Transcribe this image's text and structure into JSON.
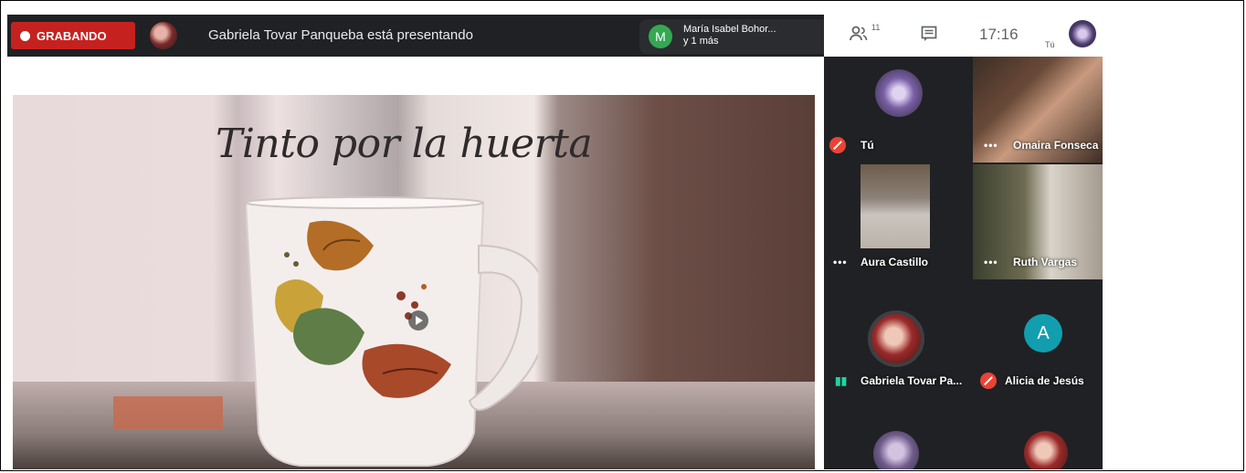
{
  "topbar": {
    "recording_label": "GRABANDO",
    "presenting_text": "Gabriela Tovar Panqueba está presentando",
    "host": {
      "initial": "M",
      "name_line1": "María Isabel Bohor...",
      "name_line2": "y 1 más"
    }
  },
  "side_controls": {
    "people_count": "11",
    "time": "17:16",
    "you_label": "Tú"
  },
  "slide": {
    "title": "Tinto por la huerta"
  },
  "participants": [
    {
      "name": "Tú",
      "muted": true
    },
    {
      "name": "Omaira Fonseca",
      "muted": false
    },
    {
      "name": "Aura Castillo",
      "muted": false
    },
    {
      "name": "Ruth Vargas",
      "muted": false
    },
    {
      "name": "Gabriela Tovar Pa...",
      "speaking": true
    },
    {
      "name": "Alicia de Jesús",
      "muted": true,
      "initial": "A"
    }
  ],
  "colors": {
    "meet_dark": "#202124",
    "record_red": "#c5221f",
    "host_green": "#34a853",
    "alicia_teal": "#129eaf",
    "mic_off_red": "#ea4335",
    "speaking_teal": "#1ed4a0"
  },
  "icons": [
    "record-dot-icon",
    "people-icon",
    "chat-icon",
    "mic-off-icon",
    "more-dots-icon",
    "speaking-icon",
    "play-icon"
  ]
}
